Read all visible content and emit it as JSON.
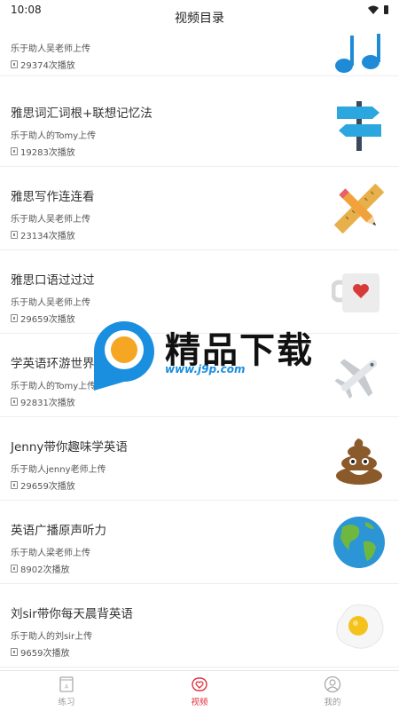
{
  "status": {
    "time": "10:08"
  },
  "header": {
    "title": "视频目录"
  },
  "videos": [
    {
      "title": "",
      "uploader": "乐于助人吴老师上传",
      "plays": "29374次播放",
      "icon": "music-notes-icon"
    },
    {
      "title": "雅思词汇词根+联想记忆法",
      "uploader": "乐于助人的Tomy上传",
      "plays": "19283次播放",
      "icon": "signpost-icon"
    },
    {
      "title": "雅思写作连连看",
      "uploader": "乐于助人吴老师上传",
      "plays": "23134次播放",
      "icon": "pencil-ruler-icon"
    },
    {
      "title": "雅思口语过过过",
      "uploader": "乐于助人吴老师上传",
      "plays": "29659次播放",
      "icon": "heart-mug-icon"
    },
    {
      "title": "学英语环游世界",
      "uploader": "乐于助人的Tomy上传",
      "plays": "92831次播放",
      "icon": "airplane-icon"
    },
    {
      "title": "Jenny带你趣味学英语",
      "uploader": "乐于助人jenny老师上传",
      "plays": "29659次播放",
      "icon": "poop-emoji-icon"
    },
    {
      "title": "英语广播原声听力",
      "uploader": "乐于助人梁老师上传",
      "plays": "8902次播放",
      "icon": "globe-icon"
    },
    {
      "title": "刘sir带你每天晨背英语",
      "uploader": "乐于助人的刘sir上传",
      "plays": "9659次播放",
      "icon": "fried-egg-icon"
    }
  ],
  "tabbar": {
    "tabs": [
      {
        "label": "练习",
        "icon": "book-icon",
        "active": false
      },
      {
        "label": "视频",
        "icon": "heart-tv-icon",
        "active": true
      },
      {
        "label": "我的",
        "icon": "user-icon",
        "active": false
      }
    ]
  },
  "watermark": {
    "brand": "精品下载",
    "url": "www.j9p.com"
  },
  "colors": {
    "accent": "#e0303c",
    "divider": "#eeeeee",
    "watermark_blue": "#1a8fe0"
  }
}
